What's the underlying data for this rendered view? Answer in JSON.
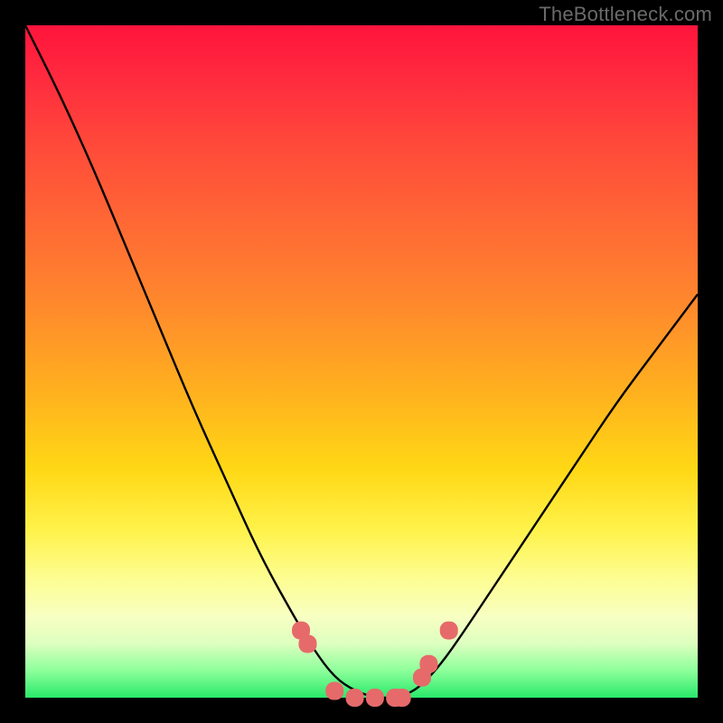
{
  "watermark": "TheBottleneck.com",
  "chart_data": {
    "type": "line",
    "title": "",
    "xlabel": "",
    "ylabel": "",
    "xlim": [
      0,
      100
    ],
    "ylim": [
      0,
      100
    ],
    "grid": false,
    "legend": false,
    "background_gradient_stops": [
      {
        "pos": 0,
        "color": "#ff143c"
      },
      {
        "pos": 18,
        "color": "#ff4a3a"
      },
      {
        "pos": 42,
        "color": "#ff8a2c"
      },
      {
        "pos": 66,
        "color": "#ffd815"
      },
      {
        "pos": 82,
        "color": "#fdfd8f"
      },
      {
        "pos": 92,
        "color": "#dcffbf"
      },
      {
        "pos": 100,
        "color": "#29e96b"
      }
    ],
    "series": [
      {
        "name": "bottleneck-curve",
        "color": "#000000",
        "x": [
          0,
          5,
          10,
          15,
          20,
          25,
          30,
          35,
          40,
          43,
          46,
          49,
          52,
          55,
          58,
          61,
          64,
          70,
          76,
          82,
          88,
          94,
          100
        ],
        "values": [
          100,
          90,
          79,
          67,
          55,
          43,
          32,
          21,
          12,
          7,
          3,
          1,
          0,
          0,
          1,
          4,
          8,
          17,
          26,
          35,
          44,
          52,
          60
        ]
      }
    ],
    "markers": {
      "name": "highlight-dots",
      "color": "#e66a6a",
      "x": [
        41,
        42,
        46,
        49,
        52,
        55,
        56,
        59,
        60,
        63
      ],
      "values": [
        10,
        8,
        1,
        0,
        0,
        0,
        0,
        3,
        5,
        10
      ]
    }
  }
}
